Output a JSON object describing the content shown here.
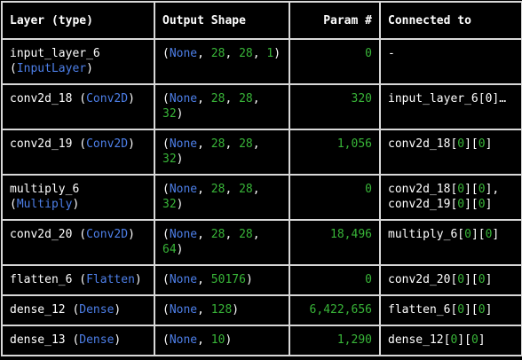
{
  "headers": {
    "layer": "Layer (type)",
    "output_shape": "Output Shape",
    "param": "Param #",
    "connected": "Connected to"
  },
  "rows": [
    {
      "name": "input_layer_6",
      "type": "InputLayer",
      "type_on_new_line": true,
      "shape": [
        "None",
        "28",
        "28",
        "1"
      ],
      "shape_wrap_after": 4,
      "params": "0",
      "connected": [
        {
          "text": "-",
          "plain": true
        }
      ]
    },
    {
      "name": "conv2d_18",
      "type": "Conv2D",
      "type_on_new_line": false,
      "shape": [
        "None",
        "28",
        "28",
        "32"
      ],
      "shape_wrap_after": 3,
      "params": "320",
      "connected": [
        {
          "text": "input_layer_6[0]…",
          "plain": true
        }
      ]
    },
    {
      "name": "conv2d_19",
      "type": "Conv2D",
      "type_on_new_line": false,
      "shape": [
        "None",
        "28",
        "28",
        "32"
      ],
      "shape_wrap_after": 3,
      "params": "1,056",
      "connected": [
        {
          "layer": "conv2d_18",
          "a": "0",
          "b": "0",
          "sep": ""
        }
      ]
    },
    {
      "name": "multiply_6",
      "type": "Multiply",
      "type_on_new_line": true,
      "shape": [
        "None",
        "28",
        "28",
        "32"
      ],
      "shape_wrap_after": 3,
      "params": "0",
      "connected": [
        {
          "layer": "conv2d_18",
          "a": "0",
          "b": "0",
          "sep": ","
        },
        {
          "layer": "conv2d_19",
          "a": "0",
          "b": "0",
          "sep": ""
        }
      ]
    },
    {
      "name": "conv2d_20",
      "type": "Conv2D",
      "type_on_new_line": false,
      "shape": [
        "None",
        "28",
        "28",
        "64"
      ],
      "shape_wrap_after": 3,
      "params": "18,496",
      "connected": [
        {
          "layer": "multiply_6",
          "a": "0",
          "b": "0",
          "sep": ""
        }
      ]
    },
    {
      "name": "flatten_6",
      "type": "Flatten",
      "type_on_new_line": false,
      "shape": [
        "None",
        "50176"
      ],
      "shape_wrap_after": 2,
      "params": "0",
      "connected": [
        {
          "layer": "conv2d_20",
          "a": "0",
          "b": "0",
          "sep": ""
        }
      ]
    },
    {
      "name": "dense_12",
      "type": "Dense",
      "type_on_new_line": false,
      "shape": [
        "None",
        "128"
      ],
      "shape_wrap_after": 2,
      "params": "6,422,656",
      "connected": [
        {
          "layer": "flatten_6",
          "a": "0",
          "b": "0",
          "sep": ""
        }
      ]
    },
    {
      "name": "dense_13",
      "type": "Dense",
      "type_on_new_line": false,
      "shape": [
        "None",
        "10"
      ],
      "shape_wrap_after": 2,
      "params": "1,290",
      "connected": [
        {
          "layer": "dense_12",
          "a": "0",
          "b": "0",
          "sep": ""
        }
      ]
    }
  ],
  "colors": {
    "background": "#000000",
    "text": "#ffffff",
    "keyword_blue": "#4d7fe8",
    "number_green": "#38b538",
    "border": "#d8d8d8"
  }
}
